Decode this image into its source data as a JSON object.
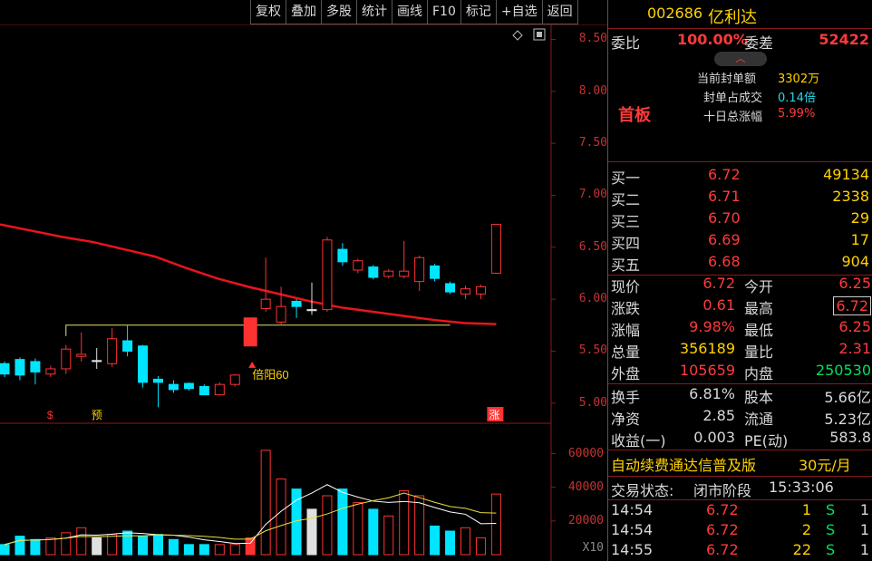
{
  "toolbar": {
    "buttons": [
      "复权",
      "叠加",
      "多股",
      "统计",
      "画线",
      "F10",
      "标记",
      "+自选",
      "返回"
    ]
  },
  "stock": {
    "code": "002686",
    "name": "亿利达"
  },
  "order_ratio": {
    "label": "委比",
    "value": "100.00%",
    "diff_label": "委差",
    "diff_value": "52422"
  },
  "limit_info": {
    "board": "首板",
    "seal_amount_label": "当前封单额",
    "seal_amount": "3302万",
    "seal_ratio_label": "封单占成交",
    "seal_ratio": "0.14倍",
    "ten_day_label": "十日总涨幅",
    "ten_day": "5.99%"
  },
  "bids": [
    {
      "label": "买一",
      "price": "6.72",
      "vol": "49134"
    },
    {
      "label": "买二",
      "price": "6.71",
      "vol": "2338"
    },
    {
      "label": "买三",
      "price": "6.70",
      "vol": "29"
    },
    {
      "label": "买四",
      "price": "6.69",
      "vol": "17"
    },
    {
      "label": "买五",
      "price": "6.68",
      "vol": "904"
    }
  ],
  "quote": [
    {
      "l1": "现价",
      "v1": "6.72",
      "c1": "red",
      "l2": "今开",
      "v2": "6.25",
      "c2": "red"
    },
    {
      "l1": "涨跌",
      "v1": "0.61",
      "c1": "red",
      "l2": "最高",
      "v2": "6.72",
      "c2": "red"
    },
    {
      "l1": "涨幅",
      "v1": "9.98%",
      "c1": "red",
      "l2": "最低",
      "v2": "6.25",
      "c2": "red"
    },
    {
      "l1": "总量",
      "v1": "356189",
      "c1": "yellow",
      "l2": "量比",
      "v2": "2.31",
      "c2": "red"
    },
    {
      "l1": "外盘",
      "v1": "105659",
      "c1": "red",
      "l2": "内盘",
      "v2": "250530",
      "c2": "green"
    }
  ],
  "fundamentals": [
    {
      "l1": "换手",
      "v1": "6.81%",
      "l2": "股本",
      "v2": "5.66亿"
    },
    {
      "l1": "净资",
      "v1": "2.85",
      "l2": "流通",
      "v2": "5.23亿"
    },
    {
      "l1": "收益(一)",
      "v1": "0.003",
      "l2": "PE(动)",
      "v2": "583.8"
    }
  ],
  "promo": {
    "text": "自动续费通达信普及版",
    "price": "30元/月"
  },
  "trade_status": {
    "label": "交易状态:",
    "value": "闭市阶段",
    "time": "15:33:06"
  },
  "ticks": [
    {
      "time": "14:54",
      "price": "6.72",
      "vol": "1",
      "side": "S",
      "num": "1"
    },
    {
      "time": "14:54",
      "price": "6.72",
      "vol": "2",
      "side": "S",
      "num": "1"
    },
    {
      "time": "14:55",
      "price": "6.72",
      "vol": "22",
      "side": "S",
      "num": "1"
    }
  ],
  "chart_annotations": {
    "pattern_label": "倍阳60",
    "markers": [
      "$",
      "预",
      "涨"
    ],
    "volume_multiplier": "X10"
  },
  "colors": {
    "up": "#ff3232",
    "down": "#00e5ff",
    "ma": "#e8141e",
    "grid": "#8a1a1a"
  },
  "chart_data": {
    "type": "candlestick",
    "ylim": [
      4.85,
      8.6
    ],
    "y_ticks": [
      "8.50",
      "8.00",
      "7.50",
      "7.00",
      "6.50",
      "6.00",
      "5.50",
      "5.00"
    ],
    "candles": [
      {
        "o": 5.28,
        "c": 5.38,
        "h": 5.4,
        "l": 5.25,
        "dir": "down"
      },
      {
        "o": 5.42,
        "c": 5.27,
        "h": 5.44,
        "l": 5.22,
        "dir": "down"
      },
      {
        "o": 5.4,
        "c": 5.3,
        "h": 5.43,
        "l": 5.18,
        "dir": "down"
      },
      {
        "o": 5.28,
        "c": 5.33,
        "h": 5.36,
        "l": 5.25,
        "dir": "up"
      },
      {
        "o": 5.33,
        "c": 5.52,
        "h": 5.56,
        "l": 5.28,
        "dir": "up"
      },
      {
        "o": 5.45,
        "c": 5.47,
        "h": 5.68,
        "l": 5.4,
        "dir": "up"
      },
      {
        "o": 5.4,
        "c": 5.41,
        "h": 5.53,
        "l": 5.33,
        "dir": "flat"
      },
      {
        "o": 5.38,
        "c": 5.62,
        "h": 5.72,
        "l": 5.35,
        "dir": "up"
      },
      {
        "o": 5.6,
        "c": 5.5,
        "h": 5.75,
        "l": 5.45,
        "dir": "down"
      },
      {
        "o": 5.55,
        "c": 5.2,
        "h": 5.56,
        "l": 5.15,
        "dir": "down"
      },
      {
        "o": 5.23,
        "c": 5.2,
        "h": 5.26,
        "l": 4.96,
        "dir": "down"
      },
      {
        "o": 5.18,
        "c": 5.13,
        "h": 5.22,
        "l": 5.1,
        "dir": "down"
      },
      {
        "o": 5.19,
        "c": 5.14,
        "h": 5.2,
        "l": 5.12,
        "dir": "down"
      },
      {
        "o": 5.16,
        "c": 5.08,
        "h": 5.18,
        "l": 5.08,
        "dir": "down"
      },
      {
        "o": 5.08,
        "c": 5.18,
        "h": 5.2,
        "l": 5.08,
        "dir": "up"
      },
      {
        "o": 5.18,
        "c": 5.27,
        "h": 5.28,
        "l": 5.16,
        "dir": "up"
      },
      {
        "o": 5.55,
        "c": 5.82,
        "h": 5.82,
        "l": 5.55,
        "dir": "up-solid"
      },
      {
        "o": 6.0,
        "c": 5.91,
        "h": 6.4,
        "l": 5.88,
        "dir": "up"
      },
      {
        "o": 5.78,
        "c": 5.93,
        "h": 6.12,
        "l": 5.75,
        "dir": "up"
      },
      {
        "o": 5.93,
        "c": 5.98,
        "h": 6.0,
        "l": 5.82,
        "dir": "down"
      },
      {
        "o": 5.89,
        "c": 5.9,
        "h": 6.16,
        "l": 5.85,
        "dir": "flat"
      },
      {
        "o": 5.9,
        "c": 6.57,
        "h": 6.6,
        "l": 5.88,
        "dir": "up"
      },
      {
        "o": 6.48,
        "c": 6.36,
        "h": 6.54,
        "l": 6.32,
        "dir": "down"
      },
      {
        "o": 6.28,
        "c": 6.37,
        "h": 6.39,
        "l": 6.25,
        "dir": "up"
      },
      {
        "o": 6.31,
        "c": 6.21,
        "h": 6.33,
        "l": 6.19,
        "dir": "down"
      },
      {
        "o": 6.22,
        "c": 6.27,
        "h": 6.29,
        "l": 6.2,
        "dir": "up"
      },
      {
        "o": 6.22,
        "c": 6.27,
        "h": 6.56,
        "l": 6.2,
        "dir": "up"
      },
      {
        "o": 6.17,
        "c": 6.4,
        "h": 6.42,
        "l": 6.08,
        "dir": "up"
      },
      {
        "o": 6.32,
        "c": 6.2,
        "h": 6.34,
        "l": 6.17,
        "dir": "down"
      },
      {
        "o": 6.15,
        "c": 6.07,
        "h": 6.17,
        "l": 6.05,
        "dir": "down"
      },
      {
        "o": 6.05,
        "c": 6.1,
        "h": 6.13,
        "l": 6.0,
        "dir": "up"
      },
      {
        "o": 6.05,
        "c": 6.12,
        "h": 6.14,
        "l": 6.0,
        "dir": "up"
      },
      {
        "o": 6.25,
        "c": 6.72,
        "h": 6.72,
        "l": 6.25,
        "dir": "up"
      }
    ],
    "ma_line": [
      6.72,
      6.66,
      6.6,
      6.55,
      6.48,
      6.41,
      6.3,
      6.2,
      6.12,
      6.05,
      5.98,
      5.92,
      5.88,
      5.84,
      5.8,
      5.77,
      5.76
    ],
    "flat_level": 5.75,
    "volume_ylim": [
      0,
      70000
    ],
    "volume_ticks": [
      "60000",
      "40000",
      "20000"
    ],
    "volume": [
      6000,
      11000,
      9000,
      10000,
      13000,
      16000,
      10000,
      12000,
      14000,
      11000,
      12000,
      9000,
      6000,
      6000,
      6000,
      6000,
      10000,
      62000,
      45000,
      39000,
      27000,
      35000,
      39000,
      31000,
      27000,
      23000,
      38000,
      35000,
      17000,
      14000,
      16000,
      10000,
      36000
    ],
    "volume_dir": [
      "down",
      "down",
      "down",
      "up",
      "up",
      "up",
      "flat",
      "up",
      "down",
      "down",
      "down",
      "down",
      "down",
      "down",
      "up",
      "up",
      "up-solid",
      "up",
      "up",
      "down",
      "flat",
      "up",
      "down",
      "up",
      "down",
      "up",
      "up",
      "up",
      "down",
      "down",
      "up",
      "up",
      "up"
    ]
  }
}
